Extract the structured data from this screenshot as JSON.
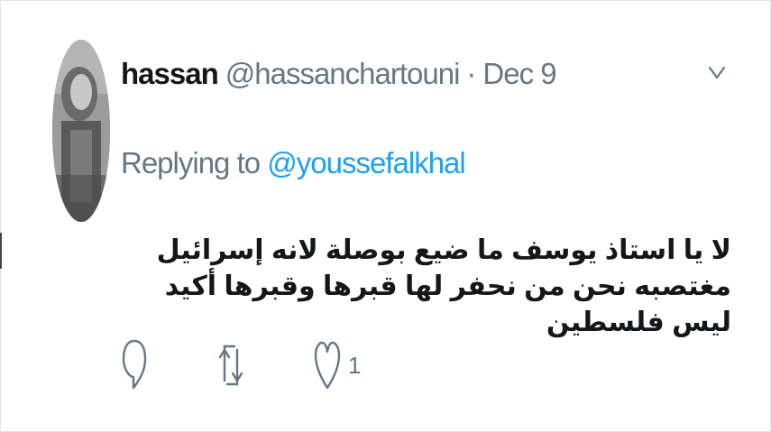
{
  "tweet": {
    "author_name": "hassan",
    "author_handle": "@hassanchartouni",
    "separator": "·",
    "date": "Dec 9",
    "replying_prefix": "Replying to",
    "replying_handle": "@youssefalkhal",
    "text": "لا يا استاذ يوسف ما ضيع بوصلة لانه إسرائيل مغتصبه نحن من نحفر لها قبرها وقبرها أكيد ليس فلسطين",
    "like_count": "1"
  },
  "icons": {
    "menu": "chevron-down-icon",
    "reply": "reply-bubble-icon",
    "retweet": "retweet-icon",
    "like": "heart-icon"
  },
  "colors": {
    "name": "#14171a",
    "secondary": "#657786",
    "link": "#1da1f2"
  }
}
